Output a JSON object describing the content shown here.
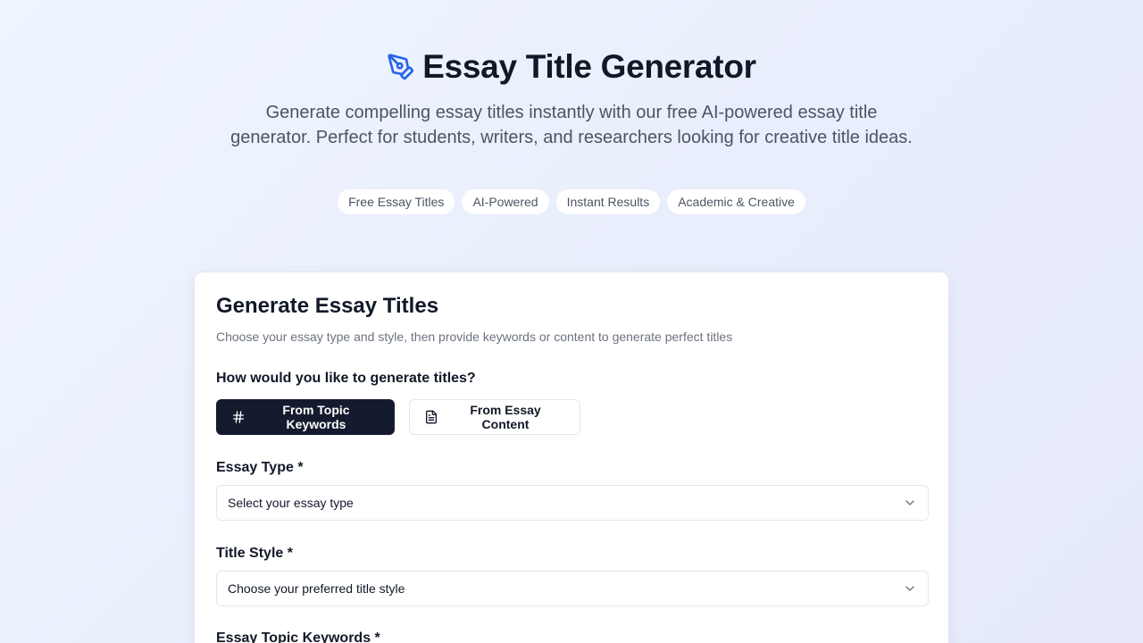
{
  "hero": {
    "icon": "pen-tool-icon",
    "title": "Essay Title Generator",
    "subtitle": "Generate compelling essay titles instantly with our free AI-powered essay title generator. Perfect for students, writers, and researchers looking for creative title ideas.",
    "tags": [
      "Free Essay Titles",
      "AI-Powered",
      "Instant Results",
      "Academic & Creative"
    ]
  },
  "card": {
    "title": "Generate Essay Titles",
    "description": "Choose your essay type and style, then provide keywords or content to generate perfect titles",
    "method_label": "How would you like to generate titles?",
    "modes": [
      {
        "label": "From Topic Keywords",
        "icon": "hash-icon",
        "active": true
      },
      {
        "label": "From Essay Content",
        "icon": "document-icon",
        "active": false
      }
    ],
    "essay_type": {
      "label": "Essay Type *",
      "placeholder": "Select your essay type"
    },
    "title_style": {
      "label": "Title Style *",
      "placeholder": "Choose your preferred title style"
    },
    "keywords": {
      "label": "Essay Topic Keywords *"
    }
  },
  "colors": {
    "accent": "#2563eb",
    "primary_button": "#151b2e",
    "background": "#eef3fd"
  }
}
